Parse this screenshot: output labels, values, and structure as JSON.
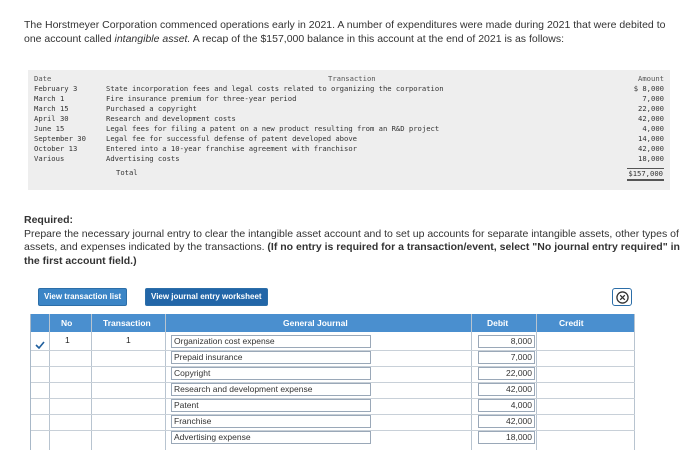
{
  "intro_text": "The Horstmeyer Corporation commenced operations early in 2021. A number of expenditures were made during 2021 that were debited to one account called",
  "intro_account": "intangible asset.",
  "intro_tail": "A recap of the $157,000 balance in this account at the end of 2021 is as follows:",
  "recap": {
    "headers": {
      "date": "Date",
      "transaction": "Transaction",
      "amount": "Amount"
    },
    "rows": [
      {
        "date": "February 3",
        "desc": "State incorporation fees and legal costs related to organizing the corporation",
        "amount": "$ 8,000"
      },
      {
        "date": "March 1",
        "desc": "Fire insurance premium for three-year period",
        "amount": "7,000"
      },
      {
        "date": "March 15",
        "desc": "Purchased a copyright",
        "amount": "22,000"
      },
      {
        "date": "April 30",
        "desc": "Research and development costs",
        "amount": "42,000"
      },
      {
        "date": "June 15",
        "desc": "Legal fees for filing a patent on a new product resulting from an R&D project",
        "amount": "4,000"
      },
      {
        "date": "September 30",
        "desc": "Legal fee for successful defense of patent developed above",
        "amount": "14,000"
      },
      {
        "date": "October 13",
        "desc": "Entered into a 10-year franchise agreement with franchisor",
        "amount": "42,000"
      },
      {
        "date": "Various",
        "desc": "Advertising costs",
        "amount": "18,000"
      }
    ],
    "total_label": "Total",
    "total_amount": "$157,000"
  },
  "required": {
    "title": "Required:",
    "body": "Prepare the necessary journal entry to clear the intangible asset account and to set up accounts for separate intangible assets, other types of assets, and expenses indicated by the transactions.",
    "note": "(If no entry is required for a transaction/event, select \"No journal entry required\" in the first account field.)"
  },
  "tabs": {
    "list": "View transaction list",
    "worksheet": "View journal entry worksheet"
  },
  "grid": {
    "headers": {
      "no": "No",
      "transaction": "Transaction",
      "general_journal": "General Journal",
      "debit": "Debit",
      "credit": "Credit"
    },
    "entry_no": "1",
    "transaction_no": "1",
    "lines": [
      {
        "account": "Organization cost expense",
        "debit": "8,000"
      },
      {
        "account": "Prepaid insurance",
        "debit": "7,000"
      },
      {
        "account": "Copyright",
        "debit": "22,000"
      },
      {
        "account": "Research and development expense",
        "debit": "42,000"
      },
      {
        "account": "Patent",
        "debit": "4,000"
      },
      {
        "account": "Franchise",
        "debit": "42,000"
      },
      {
        "account": "Advertising expense",
        "debit": "18,000"
      }
    ]
  },
  "colors": {
    "header_blue": "#4a8fcf",
    "tab_blue": "#2266a8",
    "recap_bg": "#eeeeee"
  },
  "icons": {
    "close": "close-circle-icon",
    "edit": "checkmark-icon"
  }
}
